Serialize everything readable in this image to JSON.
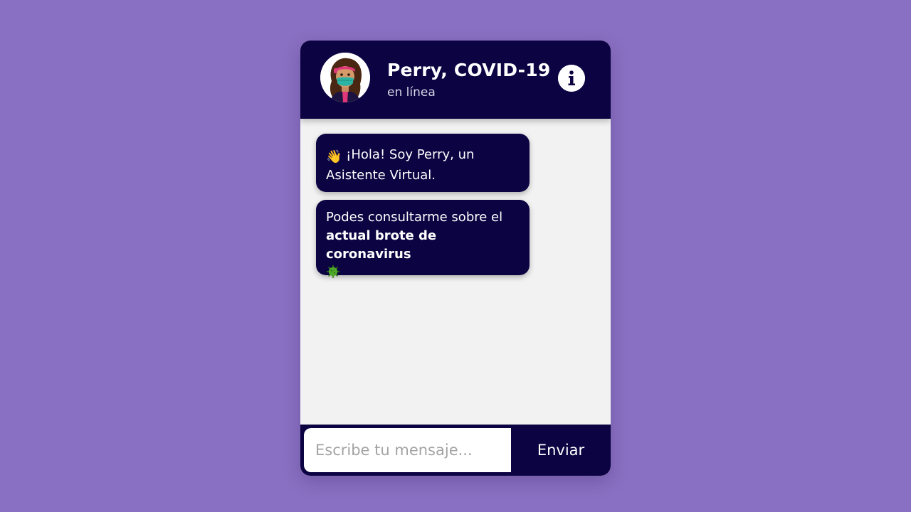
{
  "colors": {
    "background": "#8a70c2",
    "primary": "#0c0342",
    "chat_area": "#f2f2f2",
    "text_on_primary": "#ffffff",
    "placeholder": "#a3a3a3"
  },
  "header": {
    "title": "Perry, COVID-19",
    "status": "en línea",
    "avatar_icon": "masked-woman-avatar",
    "info_icon": "info-icon"
  },
  "messages": [
    {
      "emoji": "👋",
      "text": "¡Hola! Soy Perry, un Asistente Virtual."
    },
    {
      "text_start": "Podes consultarme sobre el",
      "text_bold": "actual brote de coronavirus",
      "emoji_icon": "virus-icon"
    }
  ],
  "composer": {
    "placeholder": "Escribe tu mensaje...",
    "value": "",
    "send_label": "Enviar"
  }
}
